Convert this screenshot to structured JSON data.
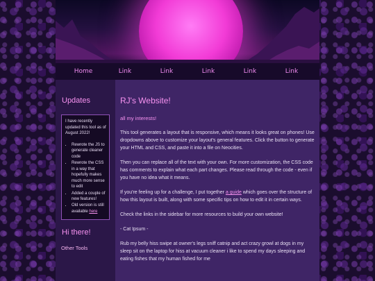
{
  "nav": [
    "Home",
    "Link",
    "Link",
    "Link",
    "Link",
    "Link"
  ],
  "sidebar": {
    "updates_title": "Updates",
    "updates_intro": "I have recently updated this tool as of August 2022!",
    "updates_items": [
      "Rewrote the JS to generate cleaner code",
      "Rewrote the CSS in a way that hopefully makes much more sense to edit",
      "Added a couple of new features!"
    ],
    "old_version_text": "Old version is still available ",
    "old_version_link": "here",
    "hi_title": "Hi there!",
    "other_tools": "Other Tools"
  },
  "main": {
    "title": "RJ's Website!",
    "subtitle": "all my interests!",
    "p1": "This tool generates a layout that is responsive, which means it looks great on phones! Use dropdowns above to customize your layout's general features. Click the button to generate your HTML and CSS, and paste it into a file on Neocities.",
    "p2": "Then you can replace all of the text with your own. For more customization, the CSS code has comments to explain what each part changes. Please read through the code - even if you have no idea what it means.",
    "p3_before": "If you're feeling up for a challenge, I put together ",
    "p3_link": "a guide",
    "p3_after": " which goes over the structure of how this layout is built, along with some specific tips on how to edit it in certain ways.",
    "p4": "Check the links in the sidebar for more resources to build your own website!",
    "p5": "- Cat Ipsum -",
    "p6": "Rub my belly hiss swipe at owner's legs sniff catnip and act crazy growl at dogs in my sleep sit on the laptop for hiss at vacuum cleaner i like to spend my days sleeping and eating fishes that my human fished for me"
  },
  "colors": {
    "accent": "#f792f0",
    "main_bg": "#3f2566",
    "sidebar_bg": "#2b1748",
    "nav_bg": "#170a2a"
  }
}
